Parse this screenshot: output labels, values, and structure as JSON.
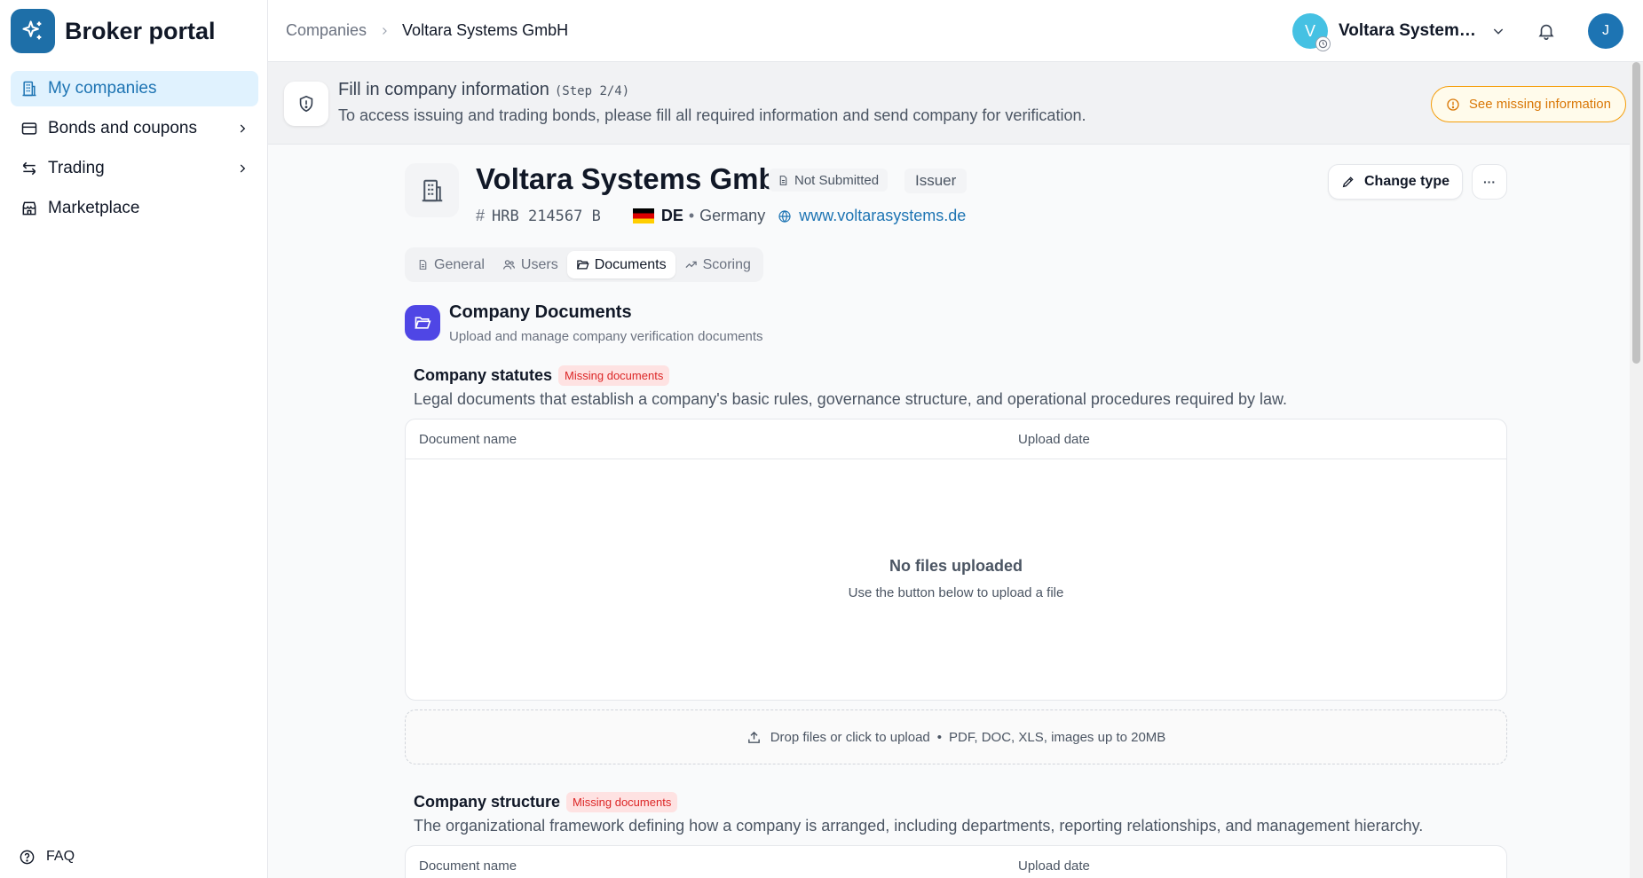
{
  "app": {
    "title": "Broker portal"
  },
  "sidebar": {
    "items": [
      {
        "label": "My companies",
        "icon": "building-icon",
        "active": true
      },
      {
        "label": "Bonds and coupons",
        "icon": "card-icon",
        "has_submenu": true
      },
      {
        "label": "Trading",
        "icon": "arrows-icon",
        "has_submenu": true
      },
      {
        "label": "Marketplace",
        "icon": "store-icon"
      }
    ],
    "faq_label": "FAQ"
  },
  "header": {
    "breadcrumb": [
      "Companies",
      "Voltara Systems GmbH"
    ],
    "org_avatar_letter": "V",
    "org_name": "Voltara Systems...",
    "user_initial": "J"
  },
  "banner": {
    "title": "Fill in company information",
    "step": "(Step 2/4)",
    "description": "To access issuing and trading bonds, please fill all required information and send company for verification.",
    "button_label": "See missing information"
  },
  "company": {
    "name": "Voltara Systems GmbH",
    "status": "Not Submitted",
    "type": "Issuer",
    "registration": "HRB 214567 B",
    "country_code": "DE",
    "country": "Germany",
    "website": "www.voltarasystems.de",
    "change_type_label": "Change type",
    "more_label": "···"
  },
  "tabs": [
    {
      "label": "General",
      "icon": "file-icon"
    },
    {
      "label": "Users",
      "icon": "users-icon"
    },
    {
      "label": "Documents",
      "icon": "folder-icon",
      "active": true
    },
    {
      "label": "Scoring",
      "icon": "trending-up-icon"
    }
  ],
  "documents": {
    "title": "Company Documents",
    "subtitle": "Upload and manage company verification documents",
    "columns": [
      "Document name",
      "Upload date"
    ],
    "empty_title": "No files uploaded",
    "empty_subtitle": "Use the button below to upload a file",
    "upload_text": "Drop files or click to upload",
    "upload_formats": "PDF, DOC, XLS, images up to 20MB",
    "bullet": "•",
    "groups": [
      {
        "title": "Company statutes",
        "badge": "Missing documents",
        "description": "Legal documents that establish a company's basic rules, governance structure, and operational procedures required by law."
      },
      {
        "title": "Company structure",
        "badge": "Missing documents",
        "description": "The organizational framework defining how a company is arranged, including departments, reporting relationships, and management hierarchy."
      }
    ]
  },
  "colors": {
    "brand": "#1e6fa8",
    "active_nav_bg": "#e0f2fe",
    "warning": "#f59e0b",
    "missing_badge": "#dc2626",
    "section_icon": "#4f46e5"
  }
}
